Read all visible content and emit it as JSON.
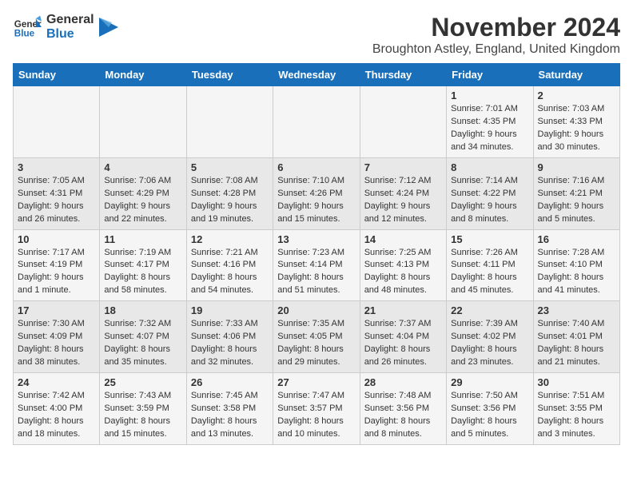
{
  "logo": {
    "text_general": "General",
    "text_blue": "Blue"
  },
  "header": {
    "month": "November 2024",
    "location": "Broughton Astley, England, United Kingdom"
  },
  "weekdays": [
    "Sunday",
    "Monday",
    "Tuesday",
    "Wednesday",
    "Thursday",
    "Friday",
    "Saturday"
  ],
  "weeks": [
    [
      {
        "day": "",
        "info": ""
      },
      {
        "day": "",
        "info": ""
      },
      {
        "day": "",
        "info": ""
      },
      {
        "day": "",
        "info": ""
      },
      {
        "day": "",
        "info": ""
      },
      {
        "day": "1",
        "info": "Sunrise: 7:01 AM\nSunset: 4:35 PM\nDaylight: 9 hours and 34 minutes."
      },
      {
        "day": "2",
        "info": "Sunrise: 7:03 AM\nSunset: 4:33 PM\nDaylight: 9 hours and 30 minutes."
      }
    ],
    [
      {
        "day": "3",
        "info": "Sunrise: 7:05 AM\nSunset: 4:31 PM\nDaylight: 9 hours and 26 minutes."
      },
      {
        "day": "4",
        "info": "Sunrise: 7:06 AM\nSunset: 4:29 PM\nDaylight: 9 hours and 22 minutes."
      },
      {
        "day": "5",
        "info": "Sunrise: 7:08 AM\nSunset: 4:28 PM\nDaylight: 9 hours and 19 minutes."
      },
      {
        "day": "6",
        "info": "Sunrise: 7:10 AM\nSunset: 4:26 PM\nDaylight: 9 hours and 15 minutes."
      },
      {
        "day": "7",
        "info": "Sunrise: 7:12 AM\nSunset: 4:24 PM\nDaylight: 9 hours and 12 minutes."
      },
      {
        "day": "8",
        "info": "Sunrise: 7:14 AM\nSunset: 4:22 PM\nDaylight: 9 hours and 8 minutes."
      },
      {
        "day": "9",
        "info": "Sunrise: 7:16 AM\nSunset: 4:21 PM\nDaylight: 9 hours and 5 minutes."
      }
    ],
    [
      {
        "day": "10",
        "info": "Sunrise: 7:17 AM\nSunset: 4:19 PM\nDaylight: 9 hours and 1 minute."
      },
      {
        "day": "11",
        "info": "Sunrise: 7:19 AM\nSunset: 4:17 PM\nDaylight: 8 hours and 58 minutes."
      },
      {
        "day": "12",
        "info": "Sunrise: 7:21 AM\nSunset: 4:16 PM\nDaylight: 8 hours and 54 minutes."
      },
      {
        "day": "13",
        "info": "Sunrise: 7:23 AM\nSunset: 4:14 PM\nDaylight: 8 hours and 51 minutes."
      },
      {
        "day": "14",
        "info": "Sunrise: 7:25 AM\nSunset: 4:13 PM\nDaylight: 8 hours and 48 minutes."
      },
      {
        "day": "15",
        "info": "Sunrise: 7:26 AM\nSunset: 4:11 PM\nDaylight: 8 hours and 45 minutes."
      },
      {
        "day": "16",
        "info": "Sunrise: 7:28 AM\nSunset: 4:10 PM\nDaylight: 8 hours and 41 minutes."
      }
    ],
    [
      {
        "day": "17",
        "info": "Sunrise: 7:30 AM\nSunset: 4:09 PM\nDaylight: 8 hours and 38 minutes."
      },
      {
        "day": "18",
        "info": "Sunrise: 7:32 AM\nSunset: 4:07 PM\nDaylight: 8 hours and 35 minutes."
      },
      {
        "day": "19",
        "info": "Sunrise: 7:33 AM\nSunset: 4:06 PM\nDaylight: 8 hours and 32 minutes."
      },
      {
        "day": "20",
        "info": "Sunrise: 7:35 AM\nSunset: 4:05 PM\nDaylight: 8 hours and 29 minutes."
      },
      {
        "day": "21",
        "info": "Sunrise: 7:37 AM\nSunset: 4:04 PM\nDaylight: 8 hours and 26 minutes."
      },
      {
        "day": "22",
        "info": "Sunrise: 7:39 AM\nSunset: 4:02 PM\nDaylight: 8 hours and 23 minutes."
      },
      {
        "day": "23",
        "info": "Sunrise: 7:40 AM\nSunset: 4:01 PM\nDaylight: 8 hours and 21 minutes."
      }
    ],
    [
      {
        "day": "24",
        "info": "Sunrise: 7:42 AM\nSunset: 4:00 PM\nDaylight: 8 hours and 18 minutes."
      },
      {
        "day": "25",
        "info": "Sunrise: 7:43 AM\nSunset: 3:59 PM\nDaylight: 8 hours and 15 minutes."
      },
      {
        "day": "26",
        "info": "Sunrise: 7:45 AM\nSunset: 3:58 PM\nDaylight: 8 hours and 13 minutes."
      },
      {
        "day": "27",
        "info": "Sunrise: 7:47 AM\nSunset: 3:57 PM\nDaylight: 8 hours and 10 minutes."
      },
      {
        "day": "28",
        "info": "Sunrise: 7:48 AM\nSunset: 3:56 PM\nDaylight: 8 hours and 8 minutes."
      },
      {
        "day": "29",
        "info": "Sunrise: 7:50 AM\nSunset: 3:56 PM\nDaylight: 8 hours and 5 minutes."
      },
      {
        "day": "30",
        "info": "Sunrise: 7:51 AM\nSunset: 3:55 PM\nDaylight: 8 hours and 3 minutes."
      }
    ]
  ]
}
